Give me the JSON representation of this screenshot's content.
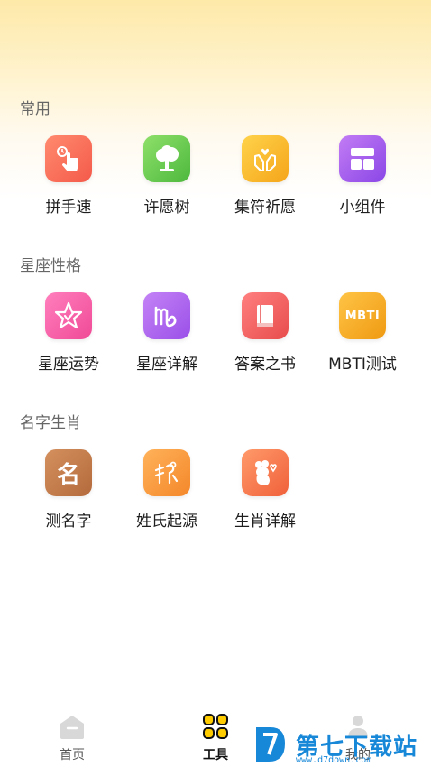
{
  "sections": {
    "common": {
      "title": "常用",
      "items": [
        {
          "label": "拼手速",
          "icon": "tap-finger-icon"
        },
        {
          "label": "许愿树",
          "icon": "tree-icon"
        },
        {
          "label": "集符祈愿",
          "icon": "praying-hands-icon"
        },
        {
          "label": "小组件",
          "icon": "widget-grid-icon"
        }
      ]
    },
    "constellation": {
      "title": "星座性格",
      "items": [
        {
          "label": "星座运势",
          "icon": "star-icon"
        },
        {
          "label": "星座详解",
          "icon": "virgo-symbol-icon"
        },
        {
          "label": "答案之书",
          "icon": "book-icon"
        },
        {
          "label": "MBTI测试",
          "icon": "mbti-icon",
          "badge": "MBTI"
        }
      ]
    },
    "name_zodiac": {
      "title": "名字生肖",
      "items": [
        {
          "label": "测名字",
          "icon": "name-char-icon",
          "badge": "名"
        },
        {
          "label": "姓氏起源",
          "icon": "ancient-script-icon"
        },
        {
          "label": "生肖详解",
          "icon": "rat-icon"
        }
      ]
    }
  },
  "tabbar": {
    "home": "首页",
    "tools": "工具",
    "mine": "我的",
    "active": "tools"
  },
  "watermark": {
    "text": "第七下载站",
    "url": "www.d7down.com"
  },
  "colors": {
    "header_gradient_top": "#fde9a8",
    "active_tab": "#111111",
    "tools_icon_yellow": "#ffcc00"
  }
}
